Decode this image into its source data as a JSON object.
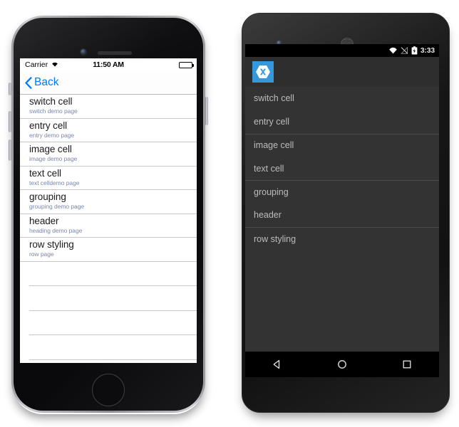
{
  "page": {
    "background_color": "#ffffff"
  },
  "ios": {
    "device_name": "iPhone",
    "status_bar": {
      "carrier": "Carrier",
      "wifi_icon": "wifi-icon",
      "time": "11:50 AM",
      "battery_icon": "battery-full-icon"
    },
    "nav_bar": {
      "back_label": "Back",
      "back_chevron_icon": "chevron-left-icon",
      "accent_color": "#007aff"
    },
    "list": {
      "title_color": "#1b1b1b",
      "subtitle_color": "#7b88a8",
      "separator_color": "#c6c6c8",
      "rows": [
        {
          "title": "switch cell",
          "subtitle": "switch demo page"
        },
        {
          "title": "entry cell",
          "subtitle": "entry demo page"
        },
        {
          "title": "image cell",
          "subtitle": "image demo page"
        },
        {
          "title": "text cell",
          "subtitle": "text celldemo page"
        },
        {
          "title": "grouping",
          "subtitle": "grouping demo page"
        },
        {
          "title": "header",
          "subtitle": "heading demo page"
        },
        {
          "title": "row styling",
          "subtitle": "row page"
        }
      ],
      "empty_row_count": 4
    }
  },
  "android": {
    "device_name": "Android phone",
    "status_bar": {
      "wifi_icon": "wifi-icon",
      "signal_icon": "signal-no-service-icon",
      "battery_icon": "battery-charging-icon",
      "time": "3:33"
    },
    "action_bar": {
      "logo_icon": "xamarin-logo-icon",
      "logo_background_color": "#3498db",
      "background_color": "#2e2e2e"
    },
    "list": {
      "background_color": "#333333",
      "text_color": "#bcbcbc",
      "separator_color": "#4a4a4a",
      "rows": [
        {
          "title": "switch cell",
          "separator_above": false
        },
        {
          "title": "entry cell",
          "separator_above": false
        },
        {
          "title": "image cell",
          "separator_above": true
        },
        {
          "title": "text cell",
          "separator_above": false
        },
        {
          "title": "grouping",
          "separator_above": true
        },
        {
          "title": "header",
          "separator_above": false
        },
        {
          "title": "row styling",
          "separator_above": true
        }
      ]
    },
    "nav_bar": {
      "back_icon": "back-triangle-icon",
      "home_icon": "home-circle-icon",
      "recents_icon": "recents-square-icon"
    }
  }
}
